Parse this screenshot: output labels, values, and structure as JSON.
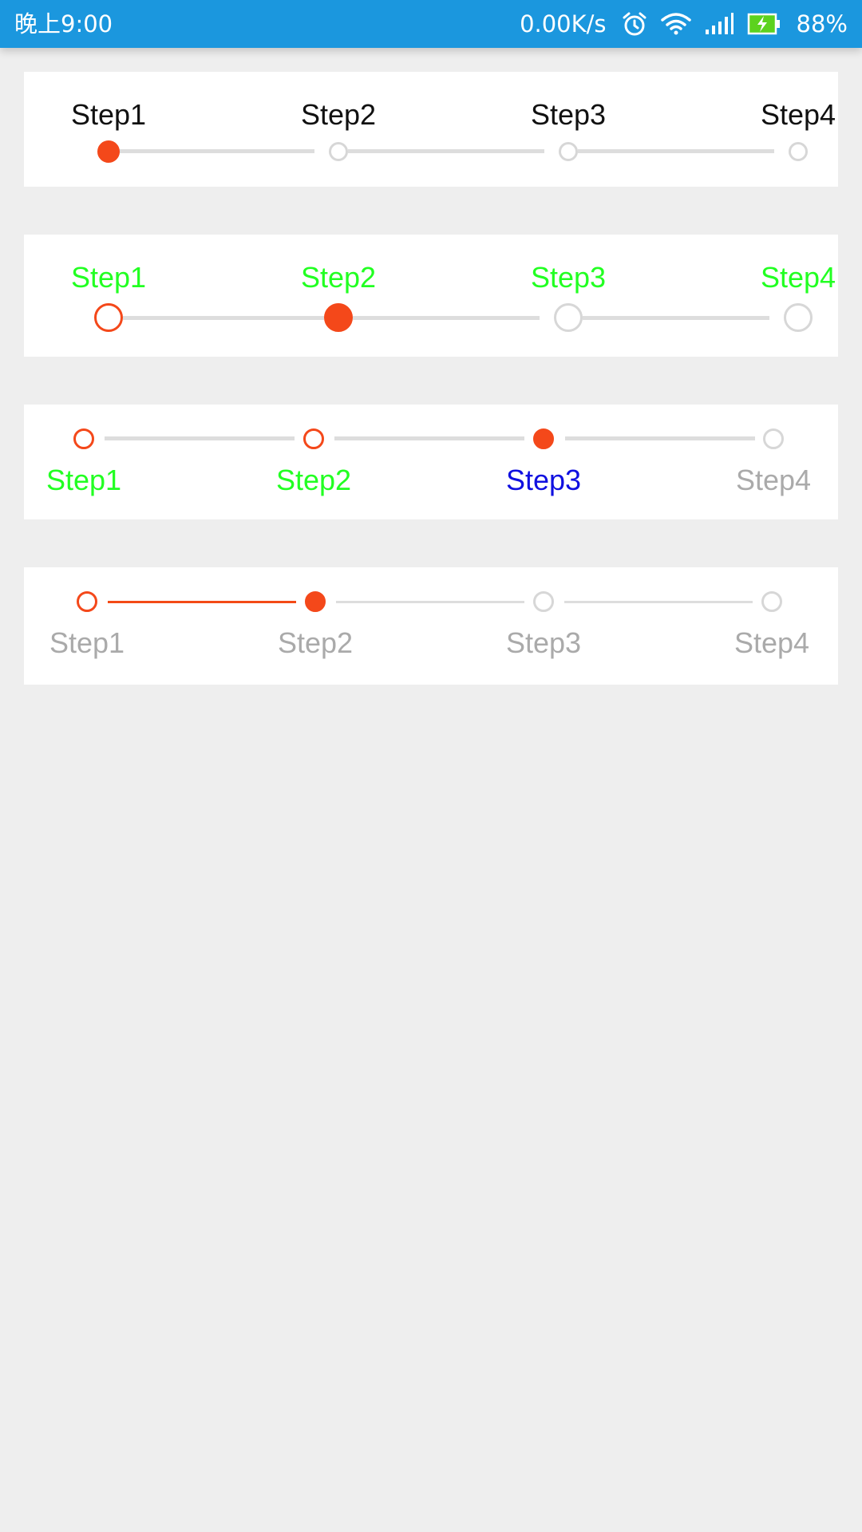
{
  "status_bar": {
    "time": "晚上9:00",
    "net_speed": "0.00K/s",
    "battery": "88%",
    "icons": [
      "alarm-icon",
      "wifi-icon",
      "signal-icon",
      "battery-charging-icon"
    ],
    "background": "#1b97de"
  },
  "colors": {
    "accent": "#f4481a",
    "inactive": "#dddddd",
    "label_green": "#22ff22",
    "label_blue": "#1010e0",
    "label_grey": "#aaaaaa",
    "page_background": "#eeeeee"
  },
  "steppers": [
    {
      "labels": [
        "Step1",
        "Step2",
        "Step3",
        "Step4"
      ],
      "current_step": 1,
      "label_position": "above"
    },
    {
      "labels": [
        "Step1",
        "Step2",
        "Step3",
        "Step4"
      ],
      "current_step": 2,
      "label_position": "above"
    },
    {
      "labels": [
        "Step1",
        "Step2",
        "Step3",
        "Step4"
      ],
      "current_step": 3,
      "label_position": "below"
    },
    {
      "labels": [
        "Step1",
        "Step2",
        "Step3",
        "Step4"
      ],
      "current_step": 2,
      "label_position": "below"
    }
  ]
}
